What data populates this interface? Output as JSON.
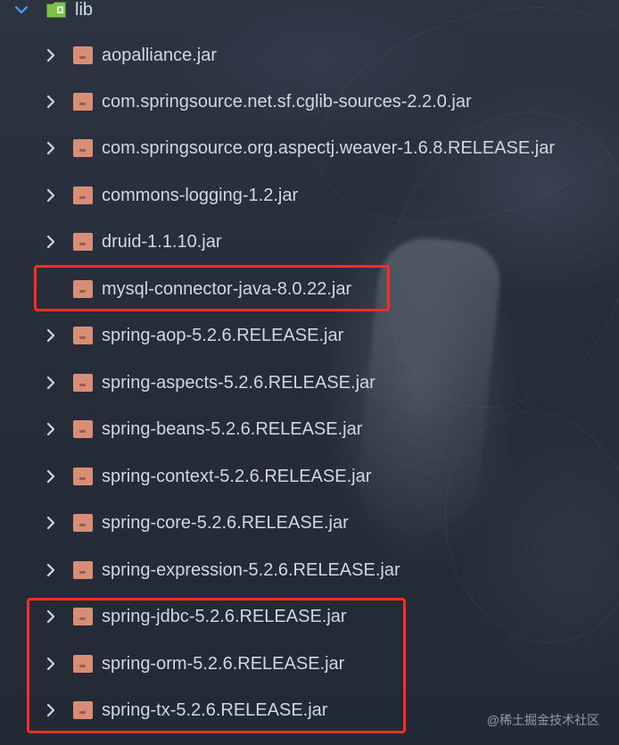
{
  "project_tree": {
    "root": {
      "label": "lib"
    },
    "items": [
      {
        "label": "aopalliance.jar"
      },
      {
        "label": "com.springsource.net.sf.cglib-sources-2.2.0.jar"
      },
      {
        "label": "com.springsource.org.aspectj.weaver-1.6.8.RELEASE.jar"
      },
      {
        "label": "commons-logging-1.2.jar"
      },
      {
        "label": "druid-1.1.10.jar"
      },
      {
        "label": "mysql-connector-java-8.0.22.jar"
      },
      {
        "label": "spring-aop-5.2.6.RELEASE.jar"
      },
      {
        "label": "spring-aspects-5.2.6.RELEASE.jar"
      },
      {
        "label": "spring-beans-5.2.6.RELEASE.jar"
      },
      {
        "label": "spring-context-5.2.6.RELEASE.jar"
      },
      {
        "label": "spring-core-5.2.6.RELEASE.jar"
      },
      {
        "label": "spring-expression-5.2.6.RELEASE.jar"
      },
      {
        "label": "spring-jdbc-5.2.6.RELEASE.jar"
      },
      {
        "label": "spring-orm-5.2.6.RELEASE.jar"
      },
      {
        "label": "spring-tx-5.2.6.RELEASE.jar"
      }
    ]
  },
  "watermark": {
    "text": "@稀土掘金技术社区"
  },
  "icons": {
    "folder": "folder-library-icon",
    "jar": "jar-file-icon",
    "expand": "chevron-right-icon",
    "collapse": "chevron-down-icon"
  },
  "colors": {
    "highlight_box": "#ff2a20",
    "folder_green": "#7bc24a",
    "jar_orange": "#d88d76"
  }
}
